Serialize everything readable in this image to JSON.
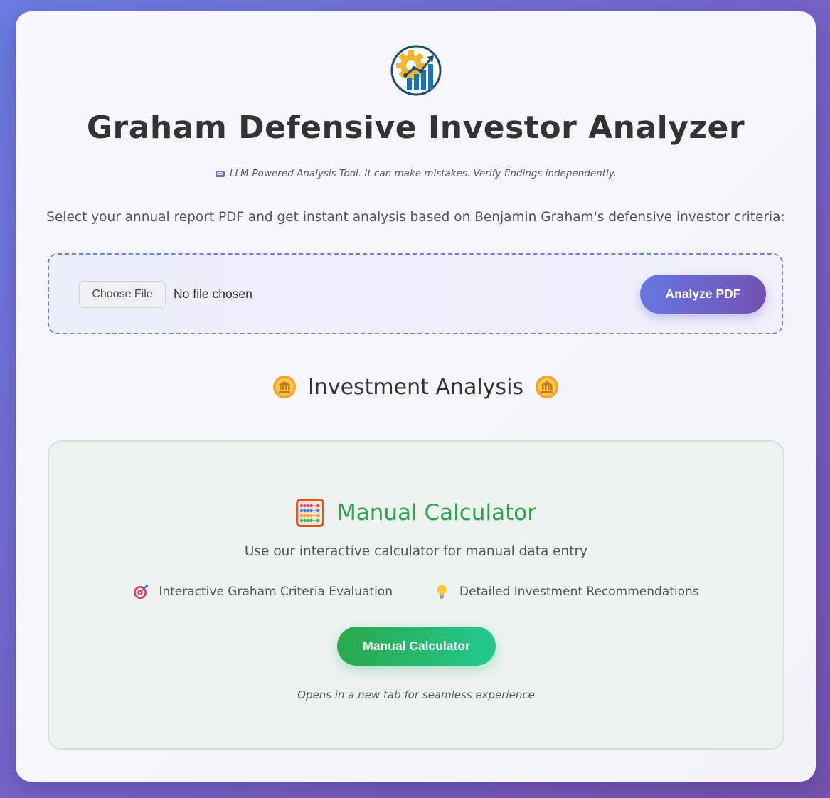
{
  "header": {
    "logo_icon": "gear-growth-chart-icon",
    "title": "Graham Defensive Investor Analyzer",
    "disclaimer_icon": "robot-icon",
    "disclaimer": "LLM-Powered Analysis Tool. It can make mistakes. Verify findings independently.",
    "intro": "Select your annual report PDF and get instant analysis based on Benjamin Graham's defensive investor criteria:"
  },
  "upload": {
    "choose_file_label": "Choose File",
    "file_status": "No file chosen",
    "analyze_label": "Analyze PDF"
  },
  "analysis_section": {
    "icon": "bank-coin-icon",
    "title": "Investment Analysis"
  },
  "manual_calculator": {
    "icon": "abacus-icon",
    "title": "Manual Calculator",
    "subtitle": "Use our interactive calculator for manual data entry",
    "features": [
      {
        "icon": "target-icon",
        "label": "Interactive Graham Criteria Evaluation"
      },
      {
        "icon": "lightbulb-icon",
        "label": "Detailed Investment Recommendations"
      }
    ],
    "button_label": "Manual Calculator",
    "note": "Opens in a new tab for seamless experience"
  },
  "colors": {
    "background_start": "#6b7be0",
    "background_end": "#7452ad",
    "primary_gradient": [
      "#6777e2",
      "#7351b2"
    ],
    "success_gradient": [
      "#2aa84c",
      "#22c98f"
    ],
    "calculator_title": "#2fa24a"
  }
}
